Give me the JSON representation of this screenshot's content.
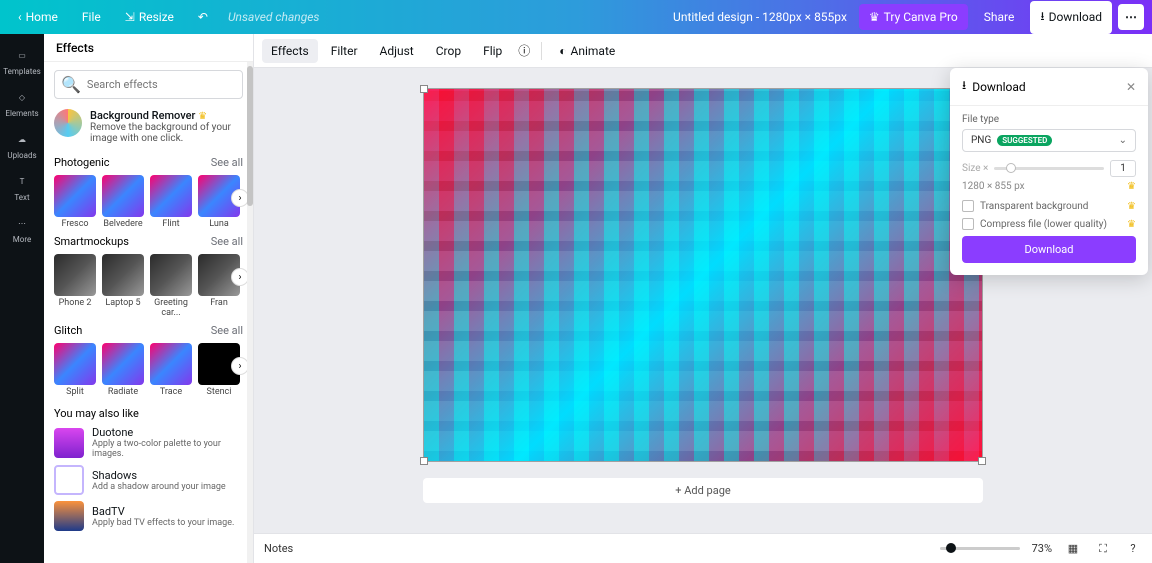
{
  "topbar": {
    "home": "Home",
    "file": "File",
    "resize": "Resize",
    "unsaved": "Unsaved changes",
    "title": "Untitled design - 1280px × 855px",
    "try_pro": "Try Canva Pro",
    "share": "Share",
    "download": "Download"
  },
  "navrail": {
    "templates": "Templates",
    "elements": "Elements",
    "uploads": "Uploads",
    "text": "Text",
    "more": "More"
  },
  "sidepanel": {
    "title": "Effects",
    "search_placeholder": "Search effects",
    "bg_remover": {
      "title": "Background Remover",
      "desc": "Remove the background of your image with one click."
    },
    "see_all": "See all",
    "cat_photogenic": "Photogenic",
    "photogenic": [
      "Fresco",
      "Belvedere",
      "Flint",
      "Luna"
    ],
    "cat_smartmockups": "Smartmockups",
    "smartmockups": [
      "Phone 2",
      "Laptop 5",
      "Greeting car...",
      "Fran"
    ],
    "cat_glitch": "Glitch",
    "glitch": [
      "Split",
      "Radiate",
      "Trace",
      "Stenci"
    ],
    "also_title": "You may also like",
    "also": [
      {
        "title": "Duotone",
        "desc": "Apply a two-color palette to your images."
      },
      {
        "title": "Shadows",
        "desc": "Add a shadow around your image"
      },
      {
        "title": "BadTV",
        "desc": "Apply bad TV effects to your image."
      }
    ]
  },
  "toolbar2": {
    "effects": "Effects",
    "filter": "Filter",
    "adjust": "Adjust",
    "crop": "Crop",
    "flip": "Flip",
    "animate": "Animate"
  },
  "add_page": "+ Add page",
  "statusbar": {
    "notes": "Notes",
    "zoom": "73%"
  },
  "download_panel": {
    "title": "Download",
    "file_type_label": "File type",
    "file_type": "PNG",
    "suggested": "SUGGESTED",
    "size_label": "Size ×",
    "size_value": "1",
    "dimensions": "1280 × 855 px",
    "transparent": "Transparent background",
    "compress": "Compress file (lower quality)",
    "button": "Download"
  }
}
